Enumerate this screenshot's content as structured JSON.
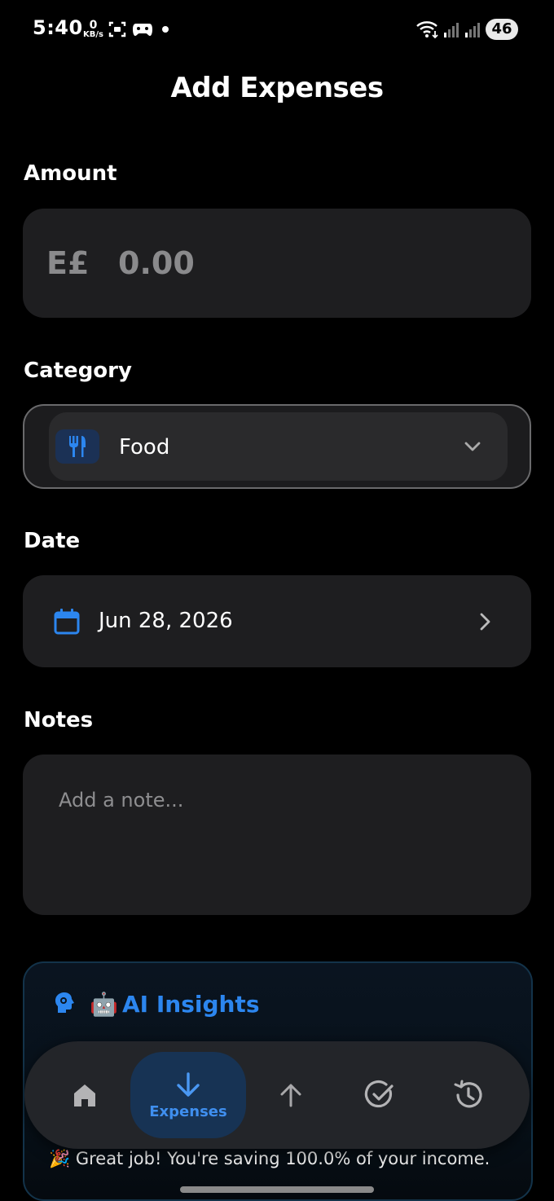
{
  "status_bar": {
    "time": "5:40",
    "speed_value": "0",
    "speed_unit": "KB/s",
    "battery": "46"
  },
  "page": {
    "title": "Add Expenses"
  },
  "amount": {
    "label": "Amount",
    "currency": "E£",
    "placeholder": "0.00"
  },
  "category": {
    "label": "Category",
    "selected": "Food",
    "icon": "fork-knife-icon"
  },
  "date": {
    "label": "Date",
    "value": "Jun 28, 2026"
  },
  "notes": {
    "label": "Notes",
    "placeholder": "Add a note..."
  },
  "ai_insights": {
    "robot_emoji": "🤖",
    "title": "AI Insights",
    "message": "🎉 Great job! You're saving 100.0% of your income."
  },
  "nav": {
    "items": [
      {
        "icon": "home-icon",
        "label": ""
      },
      {
        "icon": "arrow-down-icon",
        "label": "Expenses",
        "active": true
      },
      {
        "icon": "arrow-up-icon",
        "label": ""
      },
      {
        "icon": "check-circle-icon",
        "label": ""
      },
      {
        "icon": "history-icon",
        "label": ""
      }
    ]
  },
  "colors": {
    "accent": "#2c86ef",
    "card": "#1e1e20",
    "background": "#000000"
  }
}
